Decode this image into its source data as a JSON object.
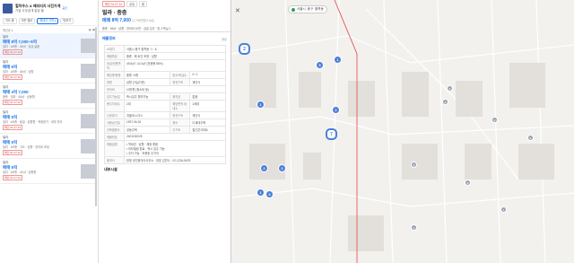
{
  "brand": {
    "name": "힐하우스 & 헤리티지 사진가게",
    "sub": "기업 사무공개 깔끔 할",
    "badge": "공인"
  },
  "filters": [
    "지도 중",
    "모든 필터",
    "최대가 가격 ▾",
    "반려가"
  ],
  "sort": {
    "left": "최신순 ▾",
    "right": "◧ ▦"
  },
  "listings": [
    {
      "type": "빌라",
      "price": "매매 8억 7,000~5억",
      "desc": "빌라 · 4/5층 · 49㎡ · 공급 넓음",
      "tag": "확인 01.27.12"
    },
    {
      "type": "빌라",
      "price": "매매 5억",
      "desc": "빌라 · 4/5층 · 45㎡ · 남향",
      "tag": "확인 01.27.12"
    },
    {
      "type": "빌라",
      "price": "매매 4억 7,000",
      "desc": "중층 · 빌라 · 45㎡ · 남동향",
      "tag": "확인 01.27.12"
    },
    {
      "type": "빌라",
      "price": "매매 5억",
      "desc": "빌라 · 4/5층 · 동일 · 남향향 · 적정한가 · 세부 관리",
      "tag": "확인 01.27.12"
    },
    {
      "type": "빌라",
      "price": "매매 5억",
      "desc": "빌라 · 4/5층 · 고도 · 남향 · 관리비 조정",
      "tag": "확인 01.27.12"
    },
    {
      "type": "빌라",
      "price": "매매 5억",
      "desc": "빌라 · 3/5층 · 42㎡ · 남향향",
      "tag": "확인 01.27.12"
    }
  ],
  "detail": {
    "top_tags": [
      "확인 01.27.12",
      "공유",
      "찜"
    ],
    "title": "빌라 · 중층",
    "price": "매매 8억 7,000",
    "price_note": "(1,700만원/3.3㎡)",
    "summary": "중층 · 49㎡ · 남향 · 관리비 10만 · 금일 입주 · 방 3 욕실 1",
    "info_title": "매물정보",
    "info_action": "공유",
    "rows": [
      [
        "소재지",
        "서울시 중구 황학동 ·1 · 6"
      ],
      [
        "매물특징",
        "중층 · 확 트인 조망 · 남향"
      ],
      [
        "공급/전용면적",
        "49.6㎡ / 42.3㎡ (전용률 85%)"
      ],
      [
        "해당층/총층",
        "중층 / 5층",
        "방수/욕실수",
        "3 / 1"
      ],
      [
        "방향",
        "남향 (거실기준)",
        "현관구조",
        "계단식"
      ],
      [
        "관리비",
        "10만원 (청소비 등)"
      ],
      [
        "입주가능일",
        "즉시입주 협의가능",
        "융자금",
        "없음"
      ],
      [
        "총주차대수",
        "2대",
        "해당면적 세대수",
        "1세대"
      ],
      [
        "난방방식",
        "개별/도시가스",
        "현관구조",
        "계단식"
      ],
      [
        "사용승인일",
        "1997.06.18",
        "용도",
        "다세대주택"
      ],
      [
        "건축물용도",
        "공동주택",
        "주구조",
        "철근콘크리트"
      ],
      [
        "매물번호",
        "2401130025"
      ],
      [
        "매물설명",
        "• 역세권 · 남향 · 채광 좋음\n• 리모델링 완료 · 즉시 입주 가능\n• 주차 가능 · 조용한 주거지"
      ],
      [
        "중개사",
        "한빛 공인중개사사무소 · 대표 김민수 · 02-1234-5678"
      ]
    ],
    "section2": "내부시설"
  },
  "map": {
    "chips": [
      "서울시",
      "중구",
      "황학동"
    ],
    "close": "✕"
  },
  "pins": [
    {
      "label": "2",
      "kind": "big"
    },
    {
      "label": "1",
      "kind": "n"
    },
    {
      "label": "5",
      "kind": "n"
    },
    {
      "label": "2",
      "kind": "n"
    },
    {
      "label": "1",
      "kind": "n"
    },
    {
      "label": "7",
      "kind": "big"
    },
    {
      "label": "2",
      "kind": "n"
    },
    {
      "label": "2",
      "kind": "n"
    },
    {
      "label": "1",
      "kind": "n"
    },
    {
      "label": "3",
      "kind": "n"
    },
    {
      "label": "2",
      "kind": "g"
    },
    {
      "label": "3",
      "kind": "g"
    },
    {
      "label": "2",
      "kind": "g"
    },
    {
      "label": "4",
      "kind": "g"
    },
    {
      "label": "3",
      "kind": "g"
    },
    {
      "label": "2",
      "kind": "g"
    },
    {
      "label": "1",
      "kind": "g"
    },
    {
      "label": "1",
      "kind": "g"
    }
  ],
  "colors": {
    "accent": "#1a73e8",
    "pin": "#4a7fd8",
    "tag": "#dd3333",
    "boundary": "#e04848"
  }
}
